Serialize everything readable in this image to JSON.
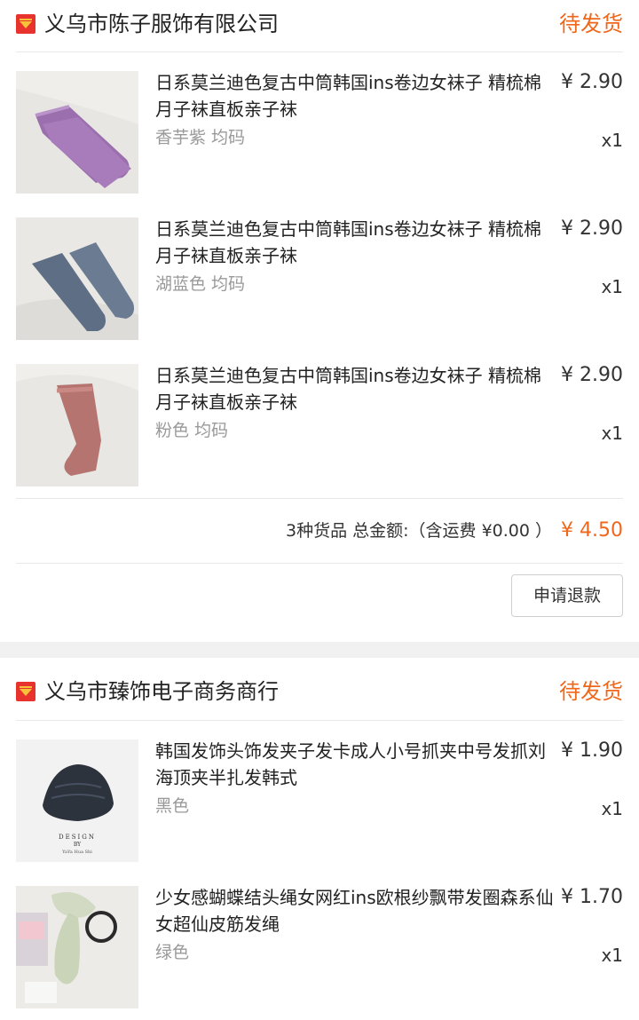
{
  "colors": {
    "accent": "#f0661a",
    "muted_text": "#999999",
    "separator": "#f1f1f1"
  },
  "orders": [
    {
      "shop_name": "义乌市陈子服饰有限公司",
      "status": "待发货",
      "items": [
        {
          "title": "日系莫兰迪色复古中筒韩国ins卷边女袜子 精梳棉月子袜直板亲子袜",
          "price": "¥ 2.90",
          "variant": "香芋紫 均码",
          "qty": "x1",
          "thumb_icon": "purple-socks"
        },
        {
          "title": "日系莫兰迪色复古中筒韩国ins卷边女袜子 精梳棉月子袜直板亲子袜",
          "price": "¥ 2.90",
          "variant": "湖蓝色 均码",
          "qty": "x1",
          "thumb_icon": "blue-socks"
        },
        {
          "title": "日系莫兰迪色复古中筒韩国ins卷边女袜子 精梳棉月子袜直板亲子袜",
          "price": "¥ 2.90",
          "variant": "粉色 均码",
          "qty": "x1",
          "thumb_icon": "pink-socks"
        }
      ],
      "summary": {
        "text": "3种货品 总金额:（含运费 ¥0.00 ）",
        "total": "¥ 4.50"
      },
      "refund_label": "申请退款"
    },
    {
      "shop_name": "义乌市臻饰电子商务商行",
      "status": "待发货",
      "items": [
        {
          "title": "韩国发饰头饰发夹子发卡成人小号抓夹中号发抓刘海顶夹半扎发韩式",
          "price": "¥ 1.90",
          "variant": "黑色",
          "qty": "x1",
          "thumb_icon": "black-hair-claw",
          "thumb_caption": [
            "DESIGN",
            "BY",
            "YaYa Hua Shi"
          ]
        },
        {
          "title": "少女感蝴蝶结头绳女网红ins欧根纱飘带发圈森系仙女超仙皮筋发绳",
          "price": "¥ 1.70",
          "variant": "绿色",
          "qty": "x1",
          "thumb_icon": "green-bow-scrunchie"
        }
      ]
    }
  ]
}
